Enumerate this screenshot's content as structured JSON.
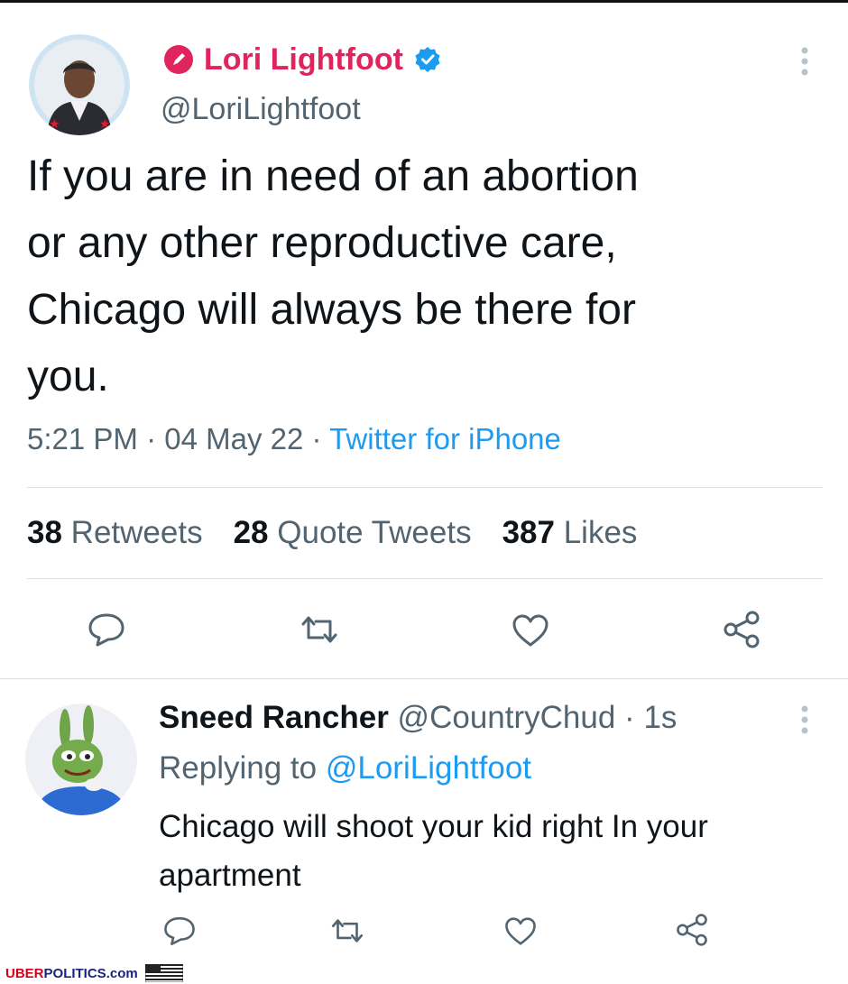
{
  "main_tweet": {
    "author_name": "Lori Lightfoot",
    "author_handle": "@LoriLightfoot",
    "verified": true,
    "text_lines": [
      "If you are in need of an abortion",
      "or any other reproductive care,",
      "Chicago will always be there for",
      "you."
    ],
    "time": "5:21 PM",
    "separator": "·",
    "date": "04 May 22",
    "source": "Twitter for iPhone",
    "stats": {
      "retweets_count": "38",
      "retweets_label": "Retweets",
      "quotes_count": "28",
      "quotes_label": "Quote Tweets",
      "likes_count": "387",
      "likes_label": "Likes"
    },
    "actions": [
      "reply-icon",
      "retweet-icon",
      "like-icon",
      "share-icon"
    ]
  },
  "reply": {
    "author_name": "Sneed Rancher",
    "author_handle": "@CountryChud",
    "separator": "·",
    "age": "1s",
    "replying_prefix": "Replying to",
    "replying_handle": "@LoriLightfoot",
    "text_lines": [
      "Chicago will shoot your kid right In your",
      "apartment"
    ],
    "actions": [
      "reply-icon",
      "retweet-icon",
      "like-icon",
      "share-icon"
    ]
  },
  "watermark": {
    "brand_uber": "UBER",
    "brand_politics": "POLITICS",
    "brand_domain": ".com"
  },
  "colors": {
    "name_accent": "#e0245e",
    "link": "#1d9bf0",
    "verified": "#1d9bf0",
    "secondary_text": "#536471",
    "watermark_red": "#d0021b",
    "watermark_blue": "#1a237e"
  }
}
